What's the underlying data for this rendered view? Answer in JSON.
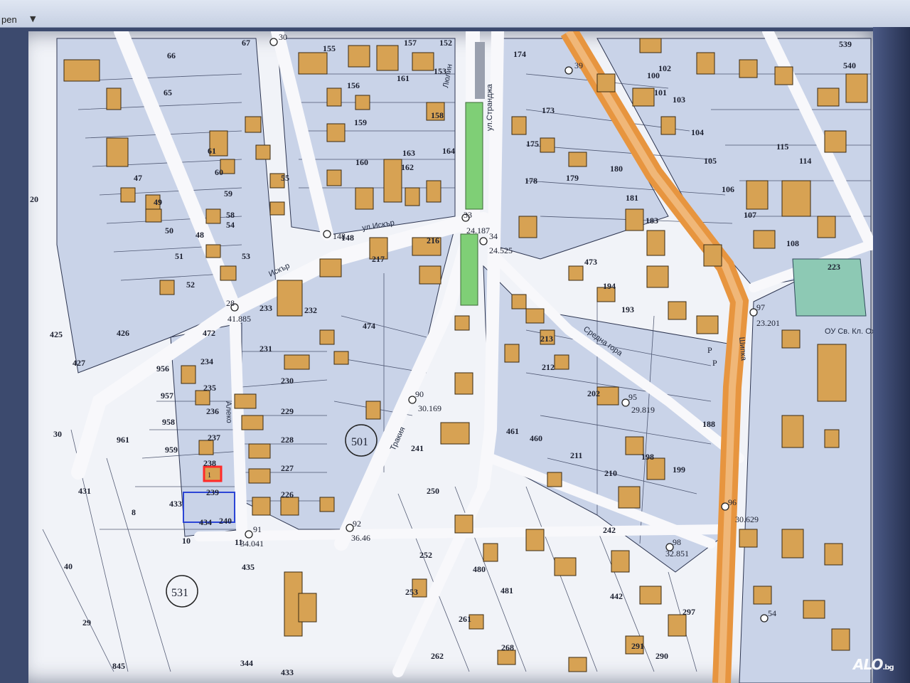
{
  "toolbar": {
    "open_label": "pen",
    "dropdown_icon": "chevron-down-icon"
  },
  "colors": {
    "road": "#f8f8fb",
    "parcel_bg": "#c9d3e8",
    "building": "#d7a253",
    "main_road": "#e7953f",
    "green_strip": "#7fcf76",
    "pond": "#8dc9b4",
    "selected_building": "#ff2a2a",
    "selected_plot": "#2b45d6"
  },
  "streets": {
    "iskar_1": "ул.Искър",
    "iskar_2": "Искър",
    "strandzha": "ул.Странджа",
    "trakiya": "Тракия",
    "sredna_gora": "Средна гора",
    "shipka": "Шипка",
    "aleko": "Алеко",
    "lyulin": "Люлин"
  },
  "survey_points": [
    {
      "id": "28",
      "elev": "41.885"
    },
    {
      "id": "33",
      "elev": "24.187"
    },
    {
      "id": "34",
      "elev": "24.525"
    },
    {
      "id": "90",
      "elev": "30.169"
    },
    {
      "id": "91",
      "elev": "34.041"
    },
    {
      "id": "92",
      "elev": "36.46"
    },
    {
      "id": "95",
      "elev": "29.819"
    },
    {
      "id": "96",
      "elev": "30.629"
    },
    {
      "id": "97",
      "elev": "23.201"
    },
    {
      "id": "98",
      "elev": "32.851"
    },
    {
      "id": "148",
      "elev": ""
    },
    {
      "id": "30",
      "elev": ""
    },
    {
      "id": "39",
      "elev": ""
    },
    {
      "id": "54",
      "elev": ""
    }
  ],
  "quarter_labels": [
    "501",
    "531"
  ],
  "parcel_labels": {
    "left": [
      "66",
      "67",
      "65",
      "61",
      "60",
      "59",
      "58",
      "55",
      "54",
      "53",
      "52",
      "51",
      "50",
      "49",
      "47",
      "48"
    ],
    "lower_left": [
      "472",
      "426",
      "425",
      "427",
      "956",
      "957",
      "958",
      "959",
      "961",
      "431",
      "433",
      "434",
      "435",
      "8",
      "10",
      "11",
      "29",
      "30",
      "40",
      "20",
      "845",
      "344",
      "433"
    ],
    "center_left": [
      "231",
      "230",
      "229",
      "228",
      "227",
      "226",
      "233",
      "232",
      "234",
      "235",
      "236",
      "237",
      "238",
      "239",
      "240"
    ],
    "center": [
      "156",
      "155",
      "157",
      "159",
      "160",
      "161",
      "162",
      "163",
      "164",
      "158",
      "152",
      "153",
      "148",
      "217",
      "216",
      "474",
      "241",
      "250",
      "252",
      "253",
      "261",
      "262",
      "268",
      "480",
      "481",
      "460",
      "461"
    ],
    "right": [
      "173",
      "174",
      "175",
      "178",
      "179",
      "180",
      "181",
      "183",
      "473",
      "193",
      "194",
      "213",
      "212",
      "211",
      "202",
      "210",
      "198",
      "199",
      "188",
      "291",
      "290",
      "297",
      "242",
      "442"
    ],
    "far_right": [
      "539",
      "540",
      "102",
      "103",
      "104",
      "105",
      "106",
      "107",
      "108",
      "115",
      "114",
      "223",
      "100",
      "101"
    ]
  },
  "map_texts": {
    "school": "ОУ Св. Кл. Охридски",
    "fuel": "Р",
    "building": "1"
  },
  "watermark": "ALO",
  "watermark_suffix": ".bg"
}
